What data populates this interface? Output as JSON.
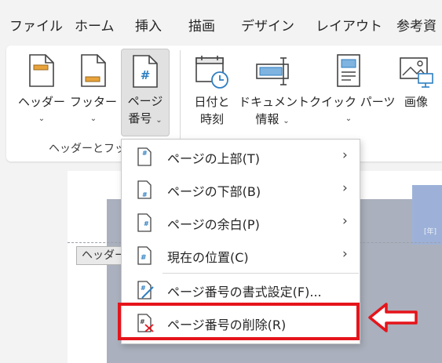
{
  "menu_tabs": [
    "ファイル",
    "ホーム",
    "挿入",
    "描画",
    "デザイン",
    "レイアウト",
    "参考資"
  ],
  "ribbon": {
    "header_btn": {
      "line1": "ヘッダー",
      "chevron": "⌄",
      "icon": "header-page-icon"
    },
    "footer_btn": {
      "line1": "フッター",
      "chevron": "⌄",
      "icon": "footer-page-icon"
    },
    "page_number_btn": {
      "line1": "ページ",
      "line2": "番号",
      "chevron": "⌄",
      "icon": "page-number-icon"
    },
    "datetime_btn": {
      "line1": "日付と",
      "line2": "時刻",
      "icon": "calendar-clock-icon"
    },
    "docinfo_btn": {
      "line1": "ドキュメント",
      "line2": "情報",
      "chevron": "⌄",
      "icon": "document-info-icon"
    },
    "quickparts_btn": {
      "line1": "クイック パーツ",
      "chevron": "⌄",
      "icon": "quick-parts-icon"
    },
    "image_btn": {
      "line1": "画像",
      "icon": "picture-icon"
    },
    "group_label": "ヘッダーとフッタ"
  },
  "document": {
    "header_tag": "ヘッダー",
    "blue_text": "[年]"
  },
  "page_number_menu": {
    "items": [
      {
        "label": "ページの上部(T)",
        "submenu": true,
        "icon": "page-top-number-icon"
      },
      {
        "label": "ページの下部(B)",
        "submenu": true,
        "icon": "page-bottom-number-icon"
      },
      {
        "label": "ページの余白(P)",
        "submenu": true,
        "icon": "page-margin-number-icon"
      },
      {
        "label": "現在の位置(C)",
        "submenu": true,
        "icon": "current-position-number-icon"
      },
      {
        "label": "ページ番号の書式設定(F)...",
        "submenu": false,
        "icon": "format-page-number-icon"
      },
      {
        "label": "ページ番号の削除(R)",
        "submenu": false,
        "icon": "remove-page-number-icon"
      }
    ],
    "submenu_glyph": "›",
    "highlighted_item": "ページ番号の削除(R)"
  },
  "colors": {
    "highlight_border": "#e5141b",
    "accent_orange": "#e8a33b",
    "accent_blue": "#2f7fc1"
  }
}
